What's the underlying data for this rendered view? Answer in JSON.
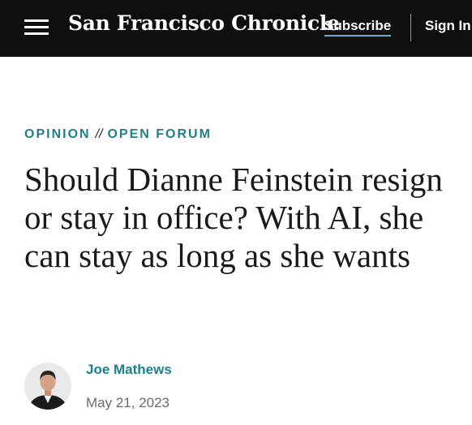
{
  "header": {
    "logo_text": "San Francisco Chronicle",
    "subscribe_label": "Subscribe",
    "signin_label": "Sign In",
    "background_color": "#0f0f0f",
    "menu_icon": "hamburger-menu-icon"
  },
  "article": {
    "kicker_section": "OPINION",
    "kicker_separator": "//",
    "kicker_subsection": "OPEN FORUM",
    "headline": "Should Dianne Feinstein resign or stay in office? With AI, she can stay as long as she wants",
    "author": "Joe Mathews",
    "date": "May 21, 2023",
    "accent_color": "#1d7f8c"
  }
}
